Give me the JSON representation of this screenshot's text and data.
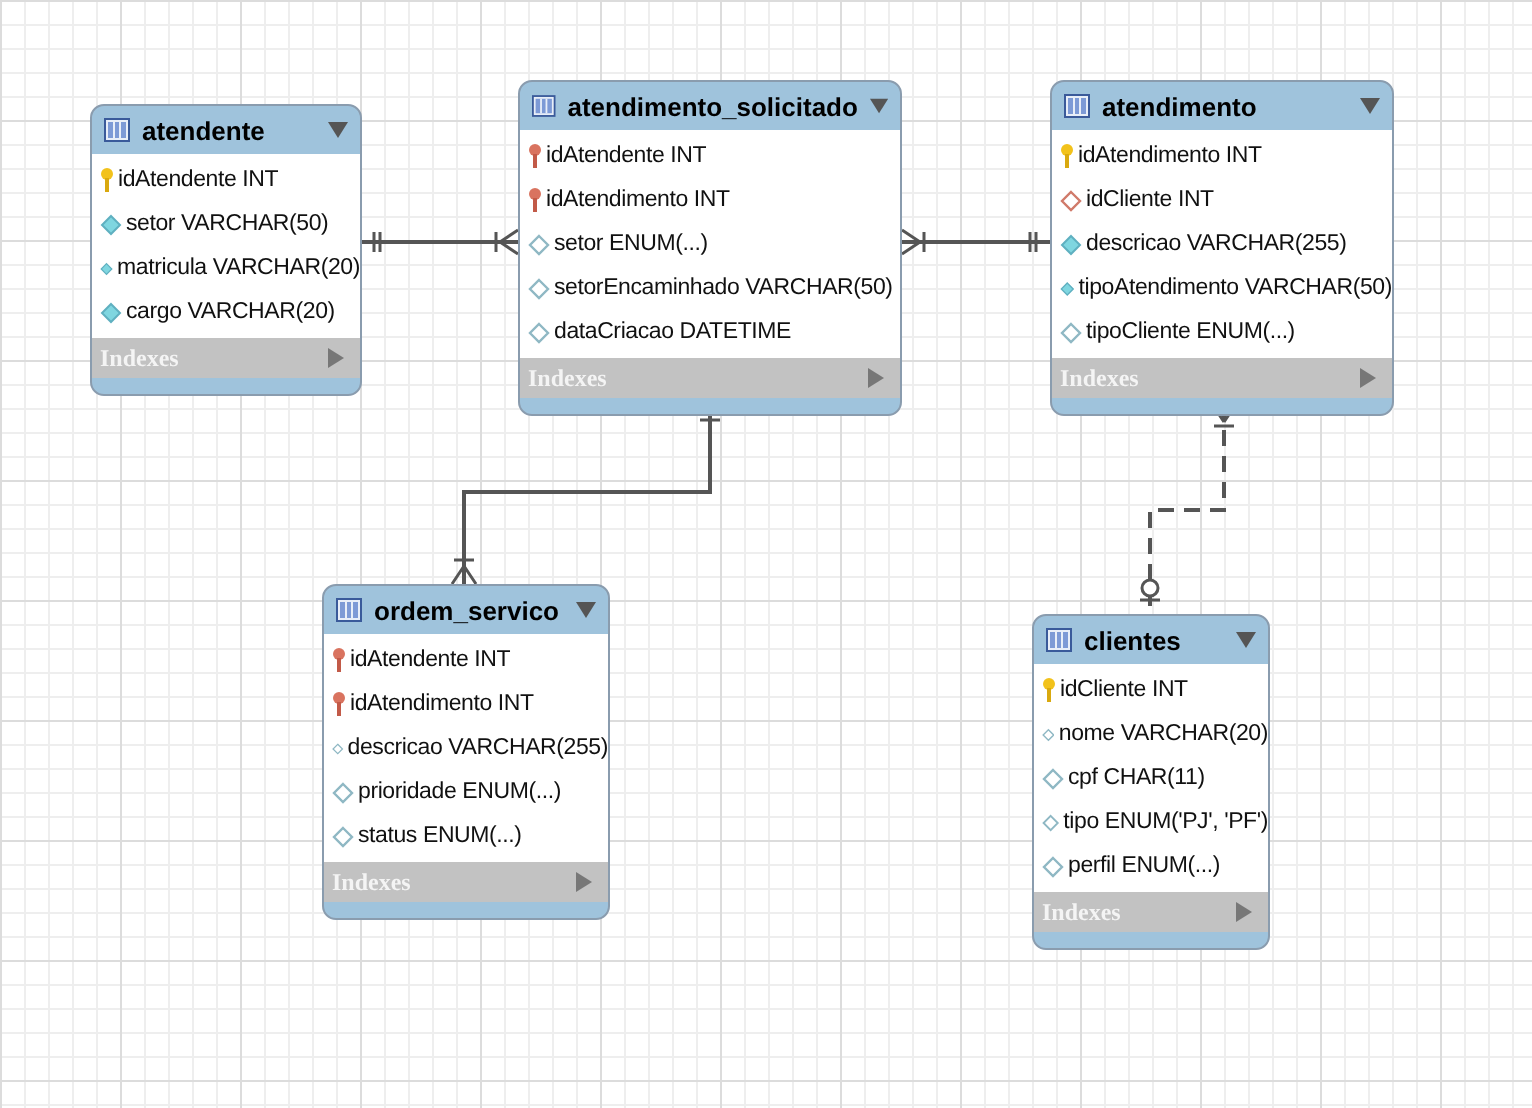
{
  "tables": [
    {
      "name": "atendente",
      "columns": [
        {
          "text": "idAtendente INT",
          "kind": "primary"
        },
        {
          "text": "setor VARCHAR(50)",
          "kind": "required"
        },
        {
          "text": "matricula VARCHAR(20)",
          "kind": "required"
        },
        {
          "text": "cargo VARCHAR(20)",
          "kind": "required"
        }
      ],
      "footer": "Indexes"
    },
    {
      "name": "atendimento_solicitado",
      "columns": [
        {
          "text": "idAtendente INT",
          "kind": "foreign_primary"
        },
        {
          "text": "idAtendimento INT",
          "kind": "foreign_primary"
        },
        {
          "text": "setor ENUM(...)",
          "kind": "optional"
        },
        {
          "text": "setorEncaminhado VARCHAR(50)",
          "kind": "optional"
        },
        {
          "text": "dataCriacao DATETIME",
          "kind": "optional"
        }
      ],
      "footer": "Indexes"
    },
    {
      "name": "atendimento",
      "columns": [
        {
          "text": "idAtendimento INT",
          "kind": "primary"
        },
        {
          "text": "idCliente INT",
          "kind": "foreign"
        },
        {
          "text": "descricao VARCHAR(255)",
          "kind": "required"
        },
        {
          "text": "tipoAtendimento VARCHAR(50)",
          "kind": "required"
        },
        {
          "text": "tipoCliente ENUM(...)",
          "kind": "optional"
        }
      ],
      "footer": "Indexes"
    },
    {
      "name": "ordem_servico",
      "columns": [
        {
          "text": "idAtendente INT",
          "kind": "foreign_primary"
        },
        {
          "text": "idAtendimento INT",
          "kind": "foreign_primary"
        },
        {
          "text": "descricao VARCHAR(255)",
          "kind": "optional"
        },
        {
          "text": "prioridade ENUM(...)",
          "kind": "optional"
        },
        {
          "text": "status ENUM(...)",
          "kind": "optional"
        }
      ],
      "footer": "Indexes"
    },
    {
      "name": "clientes",
      "columns": [
        {
          "text": "idCliente INT",
          "kind": "primary"
        },
        {
          "text": "nome VARCHAR(20)",
          "kind": "optional"
        },
        {
          "text": "cpf CHAR(11)",
          "kind": "optional"
        },
        {
          "text": "tipo ENUM('PJ', 'PF')",
          "kind": "optional"
        },
        {
          "text": "perfil ENUM(...)",
          "kind": "optional"
        }
      ],
      "footer": "Indexes"
    }
  ],
  "relationships": [
    {
      "kind": "identifying"
    },
    {
      "kind": "identifying"
    },
    {
      "kind": "identifying"
    },
    {
      "kind": "non_identifying"
    }
  ]
}
